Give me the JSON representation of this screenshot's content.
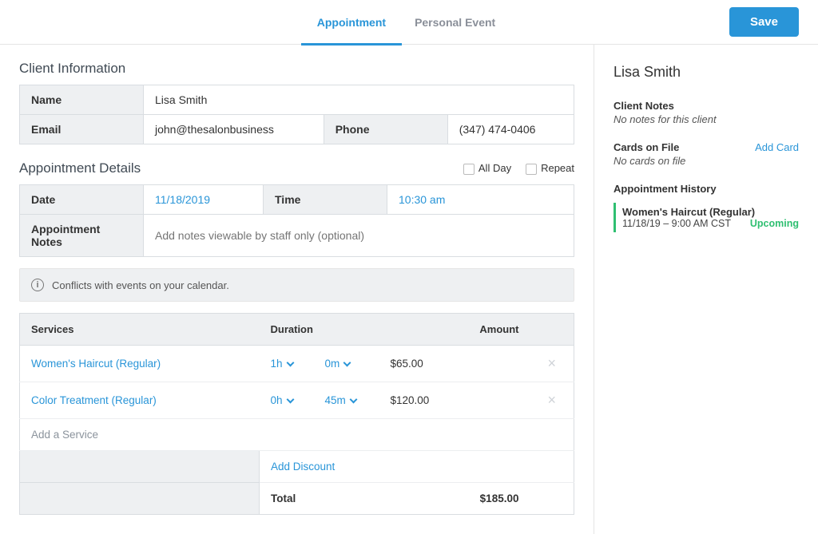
{
  "header": {
    "tabs": {
      "appointment": "Appointment",
      "personal": "Personal Event"
    },
    "save_label": "Save"
  },
  "client_info": {
    "title": "Client Information",
    "name_label": "Name",
    "name_value": "Lisa Smith",
    "email_label": "Email",
    "email_value": "john@thesalonbusiness",
    "phone_label": "Phone",
    "phone_value": "(347) 474-0406"
  },
  "appointment_details": {
    "title": "Appointment Details",
    "all_day_label": "All Day",
    "repeat_label": "Repeat",
    "date_label": "Date",
    "date_value": "11/18/2019",
    "time_label": "Time",
    "time_value": "10:30 am",
    "notes_label": "Appointment Notes",
    "notes_placeholder": "Add notes viewable by staff only (optional)"
  },
  "conflict_alert": "Conflicts with events on your calendar.",
  "services_table": {
    "headers": {
      "services": "Services",
      "duration": "Duration",
      "amount": "Amount"
    },
    "rows": [
      {
        "name": "Women's Haircut (Regular)",
        "hours": "1h",
        "minutes": "0m",
        "amount": "$65.00"
      },
      {
        "name": "Color Treatment (Regular)",
        "hours": "0h",
        "minutes": "45m",
        "amount": "$120.00"
      }
    ],
    "add_service": "Add a Service",
    "add_discount": "Add Discount",
    "total_label": "Total",
    "total_value": "$185.00"
  },
  "sidebar": {
    "client_name": "Lisa Smith",
    "notes_label": "Client Notes",
    "notes_value": "No notes for this client",
    "cards_label": "Cards on File",
    "cards_value": "No cards on file",
    "add_card": "Add Card",
    "history_label": "Appointment History",
    "history": {
      "title": "Women's Haircut (Regular)",
      "datetime": "11/18/19 – 9:00 AM CST",
      "status": "Upcoming"
    }
  }
}
